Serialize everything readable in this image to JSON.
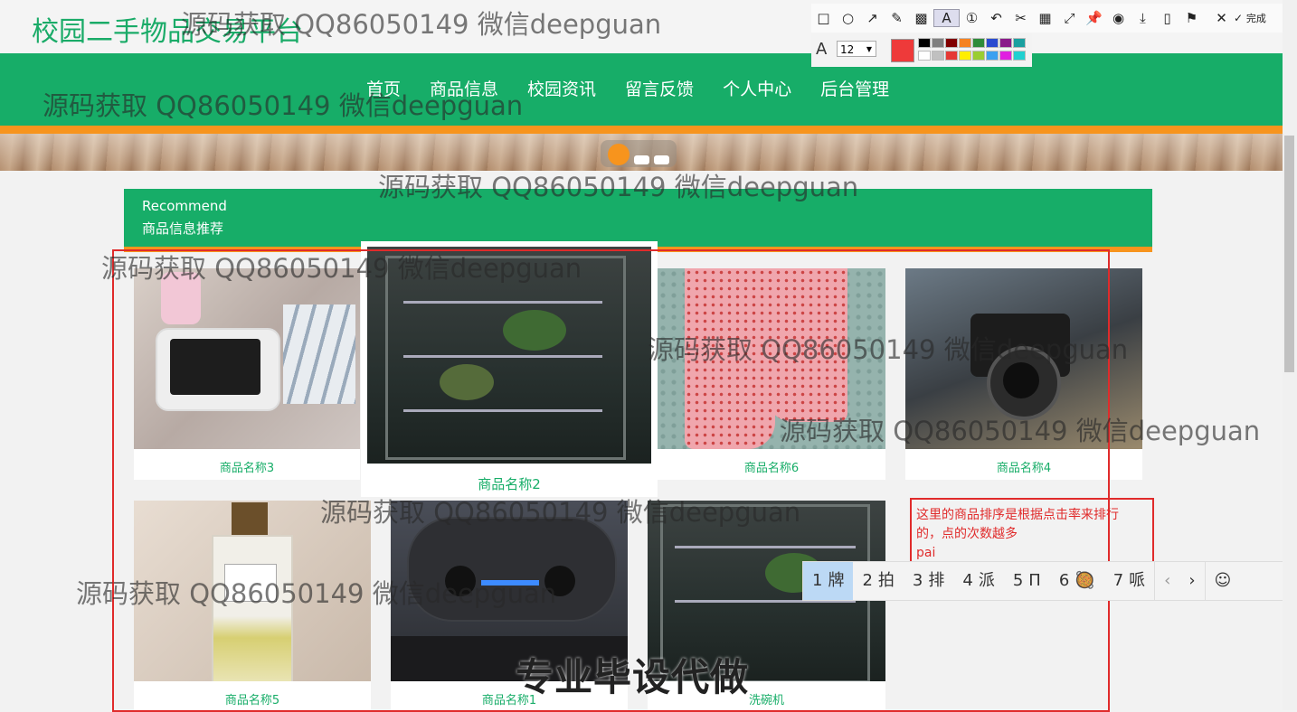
{
  "site": {
    "title": "校园二手物品交易平台"
  },
  "nav": {
    "items": [
      "首页",
      "商品信息",
      "校园资讯",
      "留言反馈",
      "个人中心",
      "后台管理"
    ]
  },
  "recommend": {
    "title_en": "Recommend",
    "title_cn": "商品信息推荐"
  },
  "products": [
    {
      "name": "商品名称3",
      "icon": "tablet-photo"
    },
    {
      "name": "商品名称2",
      "icon": "fridge-photo"
    },
    {
      "name": "商品名称6",
      "icon": "pants-photo"
    },
    {
      "name": "商品名称4",
      "icon": "camera-photo"
    },
    {
      "name": "商品名称5",
      "icon": "perfume-photo"
    },
    {
      "name": "商品名称1",
      "icon": "gamepad-photo"
    },
    {
      "name": "洗碗机",
      "icon": "dishwasher-photo"
    }
  ],
  "annotation": {
    "note": "这里的商品排序是根据点击率来排行的，点的次数越多",
    "typing": "pai"
  },
  "ime": {
    "candidates": [
      {
        "num": "1",
        "text": "牌"
      },
      {
        "num": "2",
        "text": "拍"
      },
      {
        "num": "3",
        "text": "排"
      },
      {
        "num": "4",
        "text": "派"
      },
      {
        "num": "5",
        "text": "Π"
      },
      {
        "num": "6",
        "text": "🥘"
      },
      {
        "num": "7",
        "text": "哌"
      }
    ],
    "prev": "‹",
    "next": "›",
    "emoji": "☺"
  },
  "toolbar": {
    "font_size": "12",
    "done_label": "完成",
    "active_color": "#ee3a3a",
    "palette": [
      "#000000",
      "#808080",
      "#800000",
      "#f58220",
      "#2e8b3a",
      "#2a4bd0",
      "#8a1a8a",
      "#1aa0a0",
      "#ffffff",
      "#c0c0c0",
      "#e53935",
      "#ffee00",
      "#9acd32",
      "#3aa0f0",
      "#e020e0",
      "#20d0d0"
    ]
  },
  "watermarks": [
    "源码获取 QQ86050149 微信deepguan",
    "源码获取 QQ86050149 微信deepguan",
    "源码获取 QQ86050149 微信deepguan",
    "源码获取 QQ86050149 微信deepguan",
    "源码获取 QQ86050149 微信deepguan",
    "源码获取 QQ86050149 微信deepguan",
    "源码获取 QQ86050149 微信deepguan",
    "源码获取 QQ86050149 微信deepguan"
  ],
  "promo": "专业毕设代做"
}
